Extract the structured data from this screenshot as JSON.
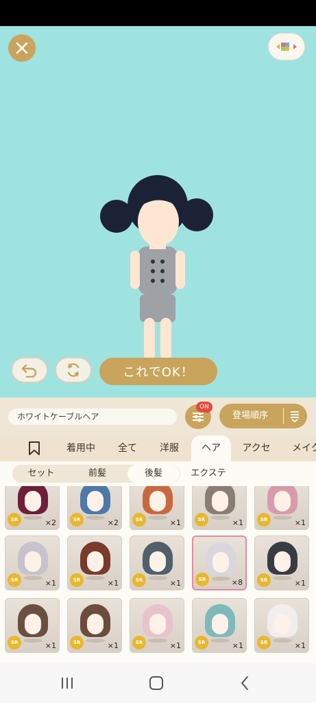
{
  "colors": {
    "stage_bg": "#9fe3e0",
    "gold": "#c9a45c",
    "badge_red": "#e54a3b",
    "sr_yellow": "#e9b72e",
    "selected_border": "#e48aa0"
  },
  "stage": {
    "close_icon": "close-icon",
    "cube_icon": "color-cube-icon",
    "undo_icon": "undo-icon",
    "refresh_icon": "refresh-icon",
    "ok_label": "これでOK！"
  },
  "toolbar": {
    "item_name": "ホワイトケーブルヘア",
    "filter_badge": "ON",
    "sort_label": "登場順序"
  },
  "tabs": [
    {
      "label": "",
      "icon": "bookmark-icon"
    },
    {
      "label": "着用中"
    },
    {
      "label": "全て"
    },
    {
      "label": "洋服"
    },
    {
      "label": "ヘア",
      "active": true
    },
    {
      "label": "アクセ"
    },
    {
      "label": "メイク"
    }
  ],
  "subtabs": [
    {
      "label": "セット"
    },
    {
      "label": "前髪"
    },
    {
      "label": "後髪",
      "active": true
    },
    {
      "label": "エクステ"
    }
  ],
  "items": [
    {
      "rarity": "SR",
      "count": "×2",
      "hair": "#6e1f3a"
    },
    {
      "rarity": "SR",
      "count": "×2",
      "hair": "#4d78a8"
    },
    {
      "rarity": "SR",
      "count": "×1",
      "hair": "#c9683f"
    },
    {
      "rarity": "SR",
      "count": "×1",
      "hair": "#8a7e72"
    },
    {
      "rarity": "SR",
      "count": "×1",
      "hair": "#d89bab"
    },
    {
      "rarity": "SR",
      "count": "×1",
      "hair": "#c7c3cc"
    },
    {
      "rarity": "SR",
      "count": "×1",
      "hair": "#7a3a2c"
    },
    {
      "rarity": "SR",
      "count": "×1",
      "hair": "#51606a"
    },
    {
      "rarity": "SR",
      "count": "×8",
      "hair": "#d9d6dd",
      "selected": true
    },
    {
      "rarity": "SR",
      "count": "×1",
      "hair": "#3a3c44"
    },
    {
      "rarity": "SR",
      "count": "×1",
      "hair": "#6b5040"
    },
    {
      "rarity": "SR",
      "count": "×1",
      "hair": "#6c4c3d"
    },
    {
      "rarity": "SR",
      "count": "×1",
      "hair": "#e8c3cb"
    },
    {
      "rarity": "SR",
      "count": "×1",
      "hair": "#7fb9bb"
    },
    {
      "rarity": "SR",
      "count": "×1",
      "hair": "#f1efee"
    }
  ],
  "nav": {
    "recents_icon": "recent-apps-icon",
    "home_icon": "home-icon",
    "back_icon": "back-icon"
  }
}
